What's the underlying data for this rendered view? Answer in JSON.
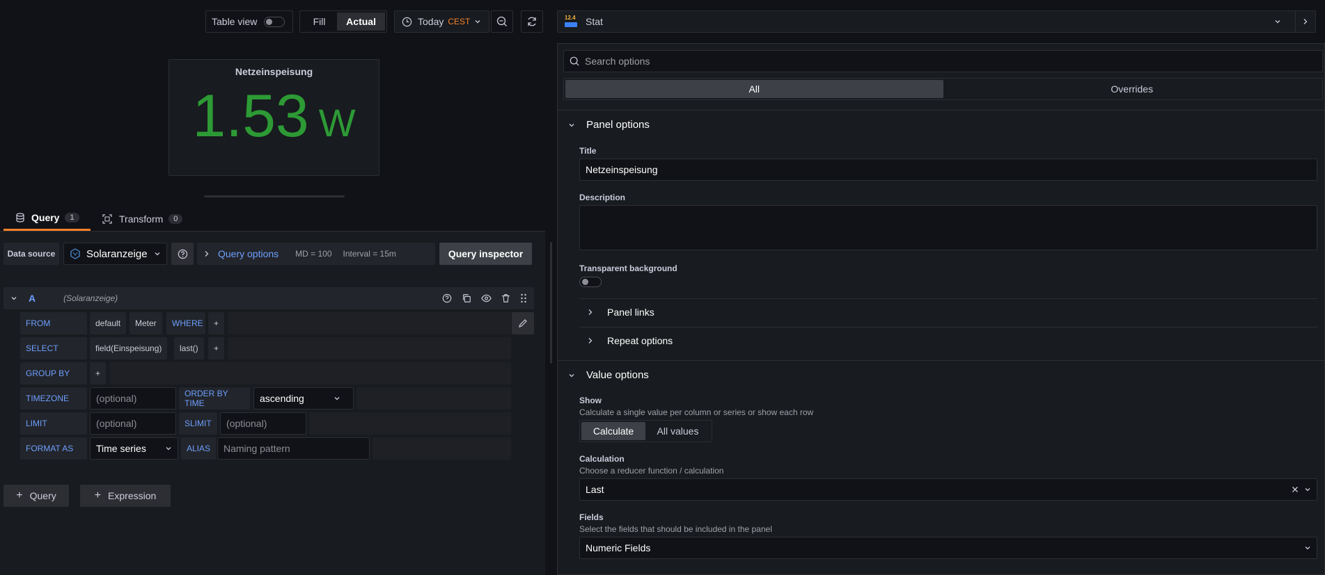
{
  "toolbar": {
    "table_view": "Table view",
    "fill": "Fill",
    "actual": "Actual",
    "time_range": "Today",
    "timezone": "CEST"
  },
  "viz": {
    "name": "Stat",
    "icon_text": "12.4"
  },
  "panel": {
    "title": "Netzeinspeisung",
    "value": "1.53",
    "unit": "W"
  },
  "tabs": {
    "query": "Query",
    "query_count": "1",
    "transform": "Transform",
    "transform_count": "0"
  },
  "datasource": {
    "label": "Data source",
    "name": "Solaranzeige",
    "query_options": "Query options",
    "md": "MD = 100",
    "interval": "Interval = 15m",
    "inspector": "Query inspector"
  },
  "query_a": {
    "ref": "A",
    "source": "(Solaranzeige)"
  },
  "builder": {
    "from": "FROM",
    "policy": "default",
    "measurement": "Meter",
    "where": "WHERE",
    "plus": "+",
    "select": "SELECT",
    "field": "field(Einspeisung)",
    "agg": "last()",
    "group_by": "GROUP BY",
    "timezone": "TIMEZONE",
    "optional": "(optional)",
    "order_by_time": "ORDER BY TIME",
    "order_value": "ascending",
    "limit": "LIMIT",
    "slimit": "SLIMIT",
    "format_as": "FORMAT AS",
    "format_value": "Time series",
    "alias": "ALIAS",
    "alias_placeholder": "Naming pattern"
  },
  "add": {
    "query": "Query",
    "expression": "Expression"
  },
  "options": {
    "search_placeholder": "Search options",
    "tab_all": "All",
    "tab_overrides": "Overrides",
    "panel_options": "Panel options",
    "title_label": "Title",
    "title_value": "Netzeinspeisung",
    "description_label": "Description",
    "transparent_label": "Transparent background",
    "panel_links": "Panel links",
    "repeat_options": "Repeat options",
    "value_options": "Value options",
    "show_label": "Show",
    "show_desc": "Calculate a single value per column or series or show each row",
    "calculate": "Calculate",
    "all_values": "All values",
    "calc_label": "Calculation",
    "calc_desc": "Choose a reducer function / calculation",
    "calc_value": "Last",
    "fields_label": "Fields",
    "fields_desc": "Select the fields that should be included in the panel",
    "fields_value": "Numeric Fields"
  },
  "colors": {
    "stat_green": "#2d9a35",
    "accent_blue": "#6e9fff",
    "orange": "#f5812b"
  }
}
